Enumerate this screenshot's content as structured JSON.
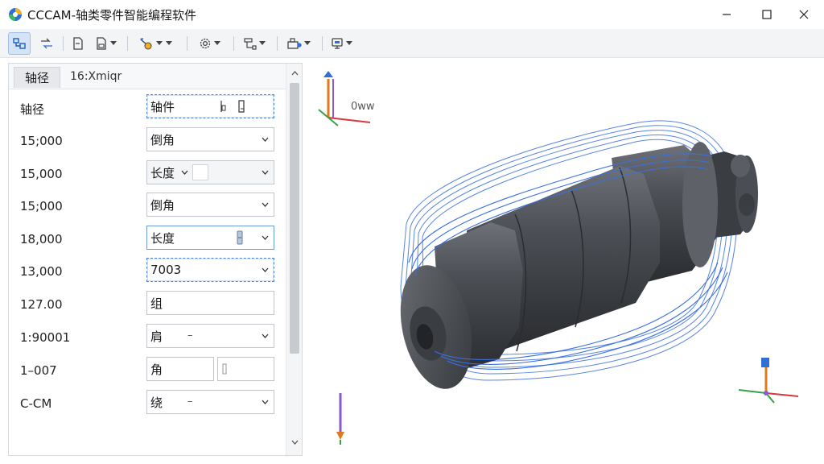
{
  "window": {
    "title": "CCCAM-轴类零件智能编程软件",
    "minimize_icon": "minimize-icon",
    "maximize_icon": "maximize-icon",
    "close_icon": "close-icon"
  },
  "toolbar": {
    "items": [
      {
        "icon": "layout-icon",
        "active": true
      },
      {
        "icon": "path-sync-icon"
      },
      {
        "icon": "document-icon"
      },
      {
        "icon": "document-settings-icon",
        "has_dropdown": true
      },
      {
        "icon": "toolpath-icon",
        "has_dropdown": true
      },
      {
        "icon": "gear-icon",
        "has_dropdown": true
      },
      {
        "icon": "tree-view-icon",
        "has_dropdown": true
      },
      {
        "icon": "machine-icon",
        "has_dropdown": true
      },
      {
        "icon": "display-icon",
        "has_dropdown": true
      }
    ]
  },
  "panel": {
    "tab_label": "轴径",
    "tab_title": "16:Xmiqr",
    "rows": [
      {
        "label": "轴径",
        "value": "轴件"
      },
      {
        "label": "15;000",
        "value": "倒角"
      },
      {
        "label": "15,000",
        "value": "长度",
        "extra_caret": true
      },
      {
        "label": "15;000",
        "value": "倒角"
      },
      {
        "label": "18,000",
        "value": "长度"
      },
      {
        "label": "13,000",
        "value": "7003"
      },
      {
        "label": "127.00",
        "value": "组"
      },
      {
        "label": "1:90001",
        "value": "肩",
        "minor": "–"
      },
      {
        "label": "1–007",
        "value": "角"
      },
      {
        "label": "C-CM",
        "value": "绕",
        "minor": "–"
      }
    ]
  },
  "viewport": {
    "axis_label": "0ww",
    "colors": {
      "part_dark": "#3e4146",
      "part_mid": "#5a5e64",
      "part_light": "#7a7e84",
      "toolpath": "#3a6fe0"
    }
  }
}
